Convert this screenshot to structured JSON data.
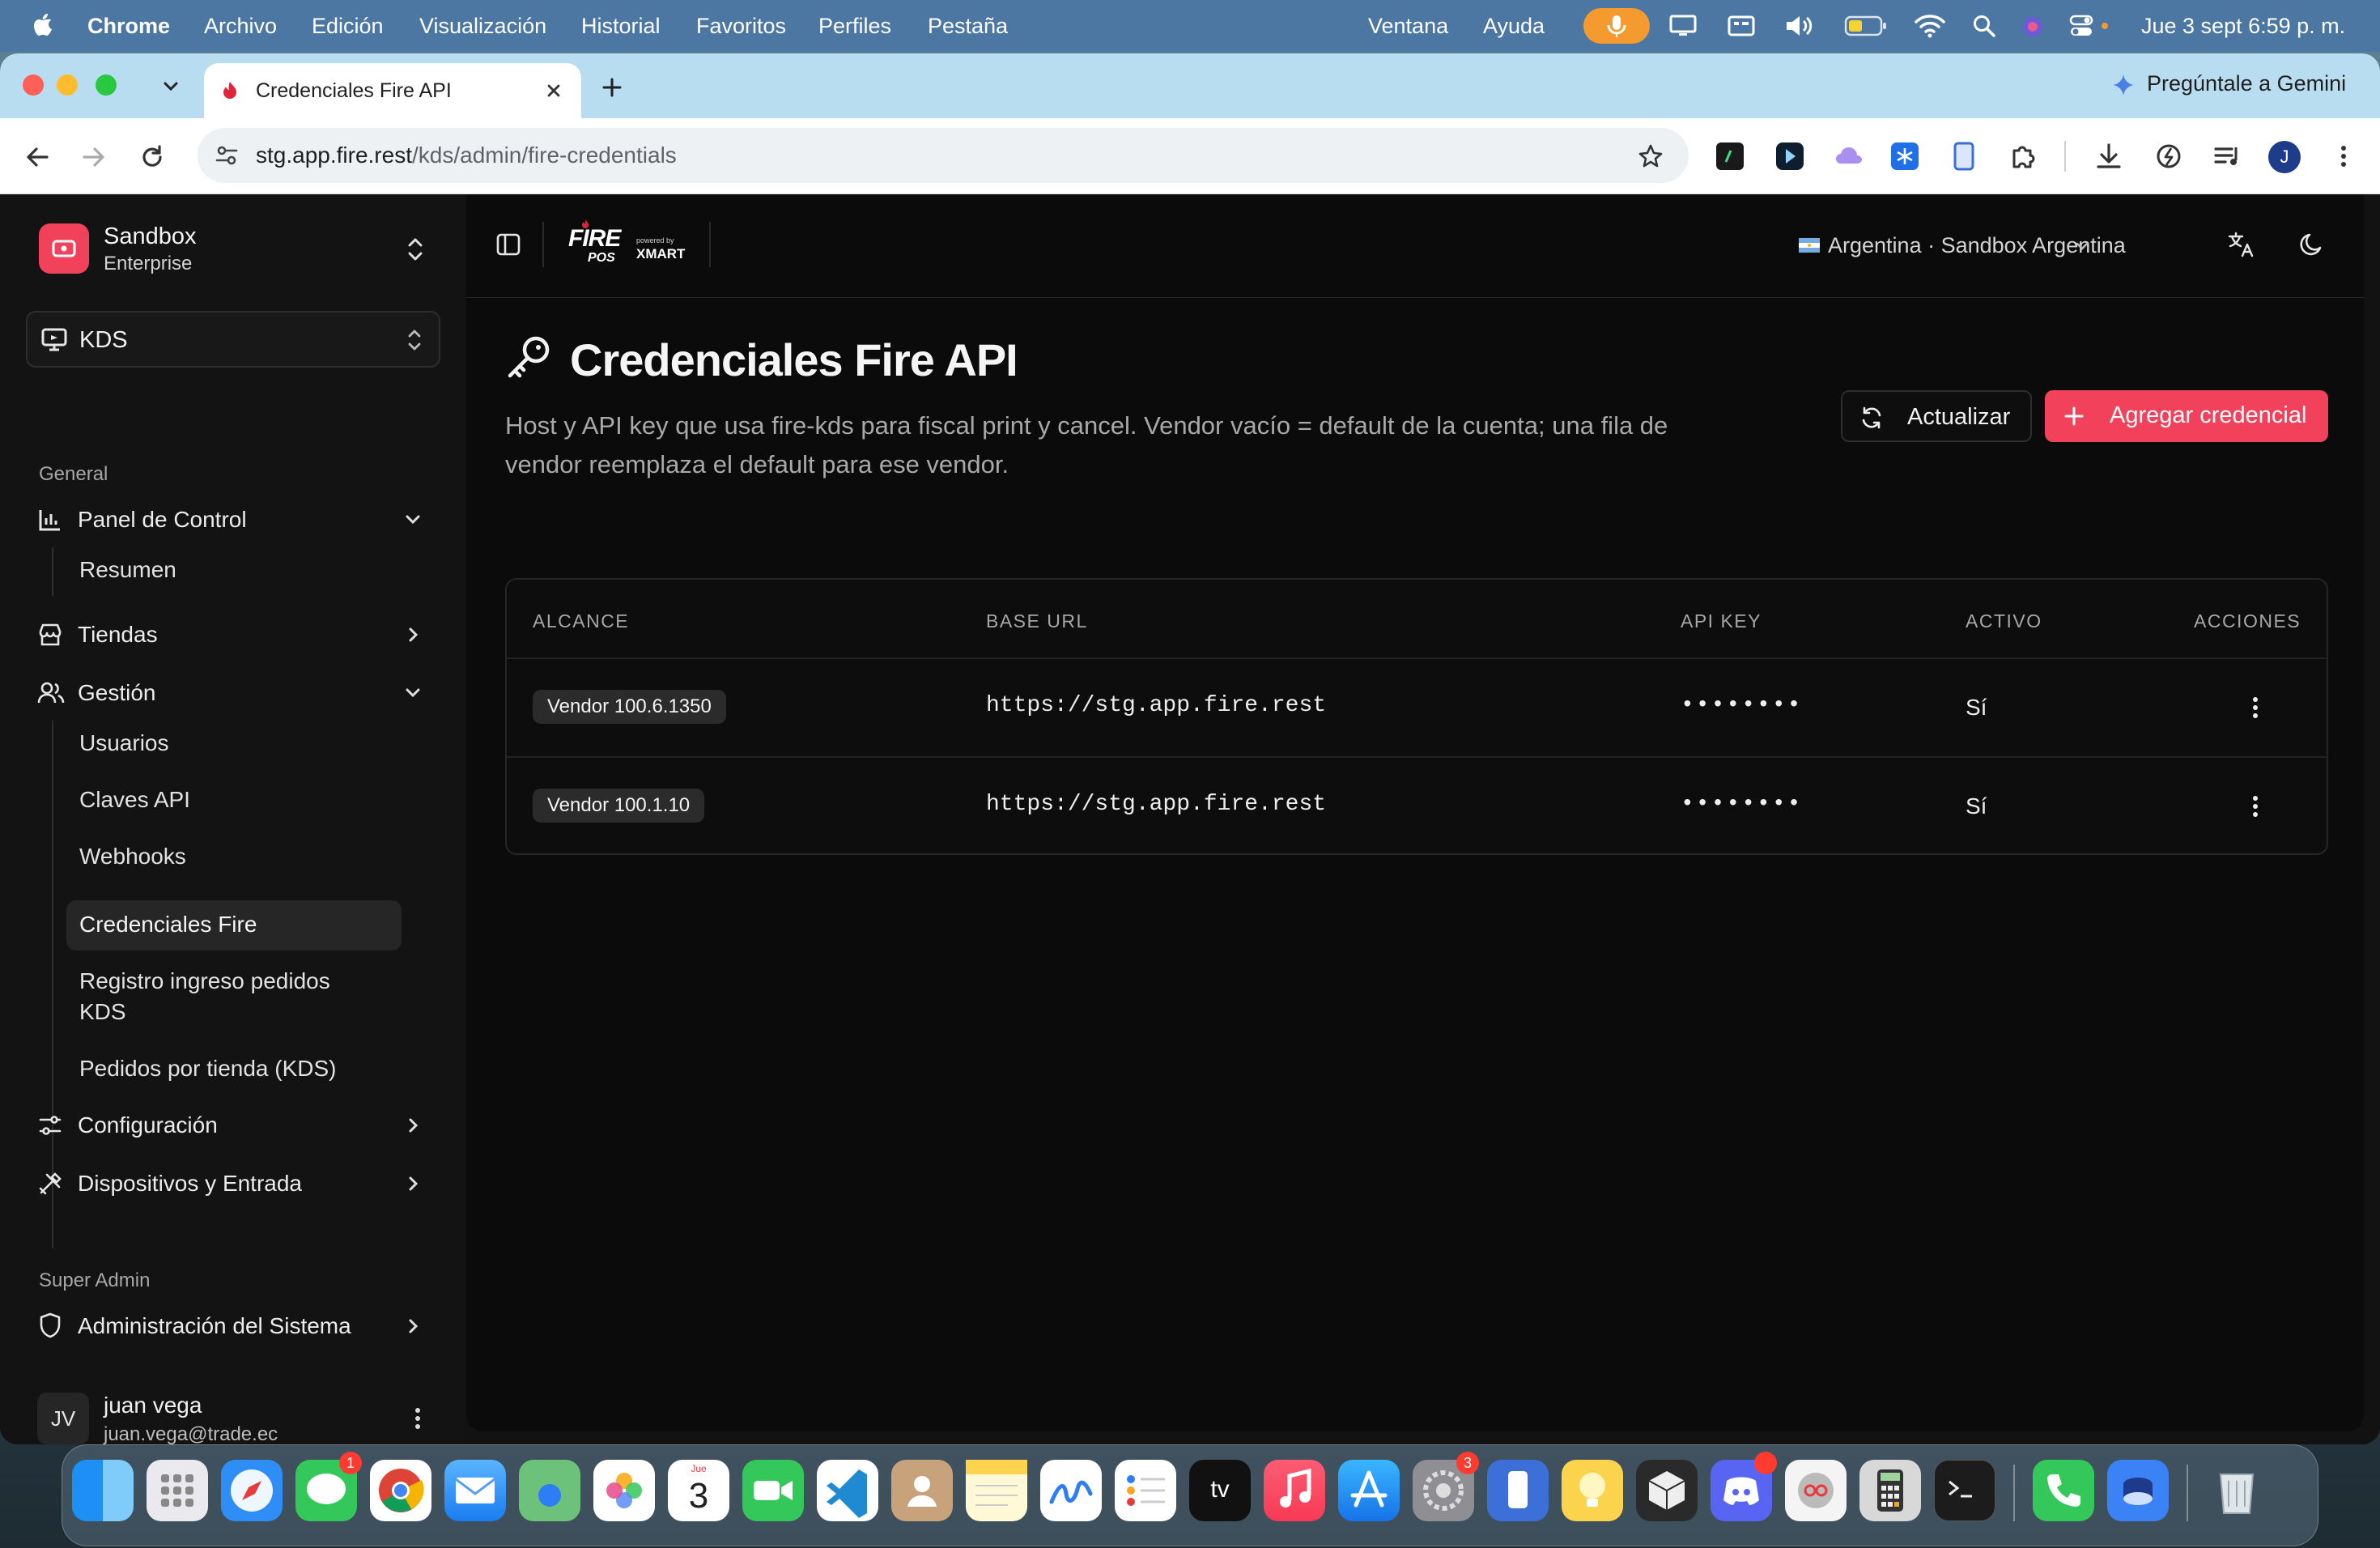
{
  "menubar": {
    "app_name": "Chrome",
    "menus": [
      "Archivo",
      "Edición",
      "Visualización",
      "Historial",
      "Favoritos",
      "Perfiles",
      "Pestaña",
      "Ventana",
      "Ayuda"
    ],
    "datetime": "Jue 3 sept  6:59 p. m."
  },
  "browser": {
    "tab_title": "Credenciales Fire API",
    "gemini_label": "Pregúntale a Gemini",
    "url_host": "stg.app.fire.rest",
    "url_path": "/kds/admin/fire-credentials",
    "profile_initial": "J"
  },
  "sidebar": {
    "org_name": "Sandbox",
    "org_plan": "Enterprise",
    "module": "KDS",
    "group_general": "General",
    "panel_control": "Panel de Control",
    "resumen": "Resumen",
    "tiendas": "Tiendas",
    "gestion": "Gestión",
    "usuarios": "Usuarios",
    "claves_api": "Claves API",
    "webhooks": "Webhooks",
    "credenciales_fire": "Credenciales Fire",
    "registro_line1": "Registro ingreso pedidos",
    "registro_line2": "KDS",
    "pedidos_tienda": "Pedidos por tienda (KDS)",
    "configuracion": "Configuración",
    "dispositivos": "Dispositivos y Entrada",
    "group_super_admin": "Super Admin",
    "admin_sistema": "Administración del Sistema",
    "user_initials": "JV",
    "user_name": "juan vega",
    "user_email": "juan.vega@trade.ec"
  },
  "topbar": {
    "logo_fire": "FIRE",
    "logo_pos": "POS",
    "logo_powered": "powered by",
    "logo_xmart": "XMART",
    "location": "Argentina · Sandbox Argentina"
  },
  "page": {
    "title": "Credenciales Fire API",
    "description_line1": "Host y API key que usa fire-kds para fiscal print y cancel. Vendor vacío = default de la cuenta; una fila de",
    "description_line2": "vendor reemplaza el default para ese vendor.",
    "refresh_label": "Actualizar",
    "add_label": "Agregar credencial"
  },
  "table": {
    "headers": {
      "scope": "ALCANCE",
      "base_url": "BASE URL",
      "api_key": "API KEY",
      "active": "ACTIVO",
      "actions": "ACCIONES"
    },
    "rows": [
      {
        "scope": "Vendor 100.6.1350",
        "base_url": "https://stg.app.fire.rest",
        "api_key": "••••••••",
        "active": "Sí"
      },
      {
        "scope": "Vendor 100.1.10",
        "base_url": "https://stg.app.fire.rest",
        "api_key": "••••••••",
        "active": "Sí"
      }
    ]
  },
  "dock": {
    "messages_badge": "1",
    "calendar_day": "3",
    "calendar_month": "Jue",
    "settings_badge": "3",
    "tv_label": "tv"
  },
  "colors": {
    "accent": "#f2425b",
    "menubar": "#4b77a2",
    "tabstrip": "#b9ddf0",
    "app_bg": "#0b0b0b"
  }
}
